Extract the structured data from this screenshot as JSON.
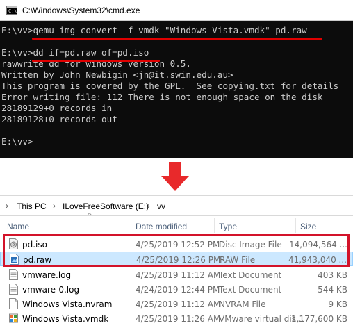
{
  "cmd": {
    "title": "C:\\Windows\\System32\\cmd.exe",
    "icon": "cmd-app-icon",
    "lines": [
      "E:\\vv>qemu-img convert -f vmdk \"Windows Vista.vmdk\" pd.raw",
      "",
      "E:\\vv>dd if=pd.raw of=pd.iso",
      "rawwrite dd for windows version 0.5.",
      "Written by John Newbigin <jn@it.swin.edu.au>",
      "This program is covered by the GPL.  See copying.txt for details",
      "Error writing file: 112 There is not enough space on the disk",
      "28189129+0 records in",
      "28189128+0 records out",
      "",
      "E:\\vv>"
    ],
    "colors": {
      "background": "#0c0c0c",
      "text": "#cccccc",
      "highlight": "#e00000"
    }
  },
  "arrow": {
    "icon": "down-arrow-icon",
    "color": "#e8292b"
  },
  "explorer": {
    "breadcrumb": [
      "This PC",
      "ILoveFreeSoftware (E:)",
      "vv"
    ],
    "columns": {
      "name": "Name",
      "date": "Date modified",
      "type": "Type",
      "size": "Size"
    },
    "files": [
      {
        "name": "pd.iso",
        "date": "4/25/2019 12:52 PM",
        "type": "Disc Image File",
        "size": "14,094,564 ...",
        "icon": "disc-image-icon",
        "selected": false
      },
      {
        "name": "pd.raw",
        "date": "4/25/2019 12:26 PM",
        "type": "RAW File",
        "size": "41,943,040 ...",
        "icon": "raw-file-icon",
        "selected": true
      },
      {
        "name": "vmware.log",
        "date": "4/25/2019 11:12 AM",
        "type": "Text Document",
        "size": "403 KB",
        "icon": "text-file-icon",
        "selected": false
      },
      {
        "name": "vmware-0.log",
        "date": "4/24/2019 12:44 PM",
        "type": "Text Document",
        "size": "544 KB",
        "icon": "text-file-icon",
        "selected": false
      },
      {
        "name": "Windows Vista.nvram",
        "date": "4/25/2019 11:12 AM",
        "type": "NVRAM File",
        "size": "9 KB",
        "icon": "blank-file-icon",
        "selected": false
      },
      {
        "name": "Windows Vista.vmdk",
        "date": "4/25/2019 11:26 AM",
        "type": "VMware virtual dis...",
        "size": "1,177,600 KB",
        "icon": "vmdk-file-icon",
        "selected": false
      }
    ],
    "colors": {
      "selection": "#cce8ff",
      "highlight_box": "#d3132a"
    }
  }
}
